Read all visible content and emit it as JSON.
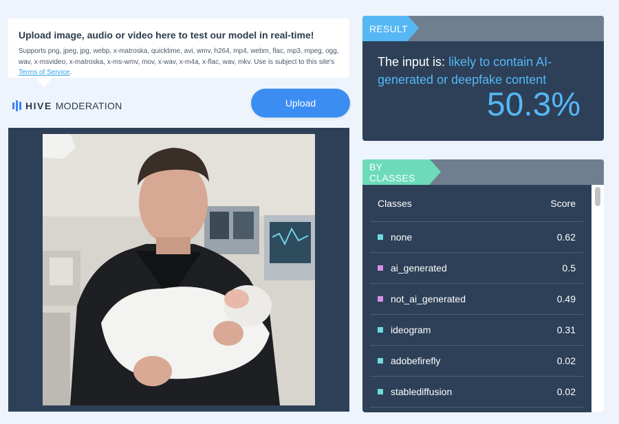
{
  "upload_info": {
    "title": "Upload image, audio or video here to test our model in real-time!",
    "description": "Supports png, jpeg, jpg, webp, x-matroska, quicktime, avi, wmv, h264, mp4, webm, flac, mp3, mpeg, ogg, wav, x-msvideo, x-matroska, x-ms-wmv, mov, x-wav, x-m4a, x-flac, wav, mkv. Use is subject to this site's ",
    "tos_link": "Terms of Service",
    "tos_suffix": "."
  },
  "logo": {
    "bold": "HIVE",
    "regular": "MODERATION"
  },
  "upload_button": {
    "label": "Upload"
  },
  "result": {
    "header": "RESULT",
    "prefix": "The input is: ",
    "verdict": "likely to contain AI-generated or deepfake content",
    "percent": "50.3%"
  },
  "classes": {
    "header": "BY CLASSES",
    "col_class": "Classes",
    "col_score": "Score",
    "rows": [
      {
        "name": "none",
        "score": "0.62",
        "color": "#6ddbe0"
      },
      {
        "name": "ai_generated",
        "score": "0.5",
        "color": "#d78ee8"
      },
      {
        "name": "not_ai_generated",
        "score": "0.49",
        "color": "#d78ee8"
      },
      {
        "name": "ideogram",
        "score": "0.31",
        "color": "#6ddbe0"
      },
      {
        "name": "adobefirefly",
        "score": "0.02",
        "color": "#6ddbe0"
      },
      {
        "name": "stablediffusion",
        "score": "0.02",
        "color": "#6ddbe0"
      }
    ]
  },
  "colors": {
    "accent_blue": "#56b7f5",
    "accent_green": "#6ddbb9",
    "panel_bg": "#2d4058",
    "button_blue": "#3b8df2"
  }
}
